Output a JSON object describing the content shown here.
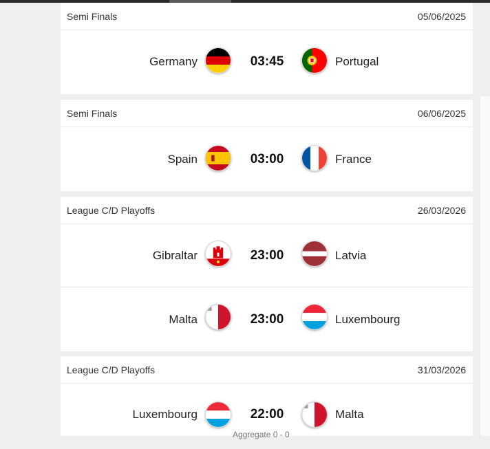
{
  "sections": [
    {
      "stage": "Semi Finals",
      "date": "05/06/2025",
      "matches": [
        {
          "home": "Germany",
          "home_flag": "germany-flag-icon",
          "time": "03:45",
          "away": "Portugal",
          "away_flag": "portugal-flag-icon"
        }
      ]
    },
    {
      "stage": "Semi Finals",
      "date": "06/06/2025",
      "matches": [
        {
          "home": "Spain",
          "home_flag": "spain-flag-icon",
          "time": "03:00",
          "away": "France",
          "away_flag": "france-flag-icon"
        }
      ]
    },
    {
      "stage": "League C/D Playoffs",
      "date": "26/03/2026",
      "matches": [
        {
          "home": "Gibraltar",
          "home_flag": "gibraltar-flag-icon",
          "time": "23:00",
          "away": "Latvia",
          "away_flag": "latvia-flag-icon"
        },
        {
          "home": "Malta",
          "home_flag": "malta-flag-icon",
          "time": "23:00",
          "away": "Luxembourg",
          "away_flag": "luxembourg-flag-icon"
        }
      ]
    },
    {
      "stage": "League C/D Playoffs",
      "date": "31/03/2026",
      "matches": [
        {
          "home": "Luxembourg",
          "home_flag": "luxembourg-flag-icon",
          "time": "22:00",
          "away": "Malta",
          "away_flag": "malta-flag-icon",
          "aggregate": "Aggregate 0 - 0"
        }
      ]
    }
  ]
}
